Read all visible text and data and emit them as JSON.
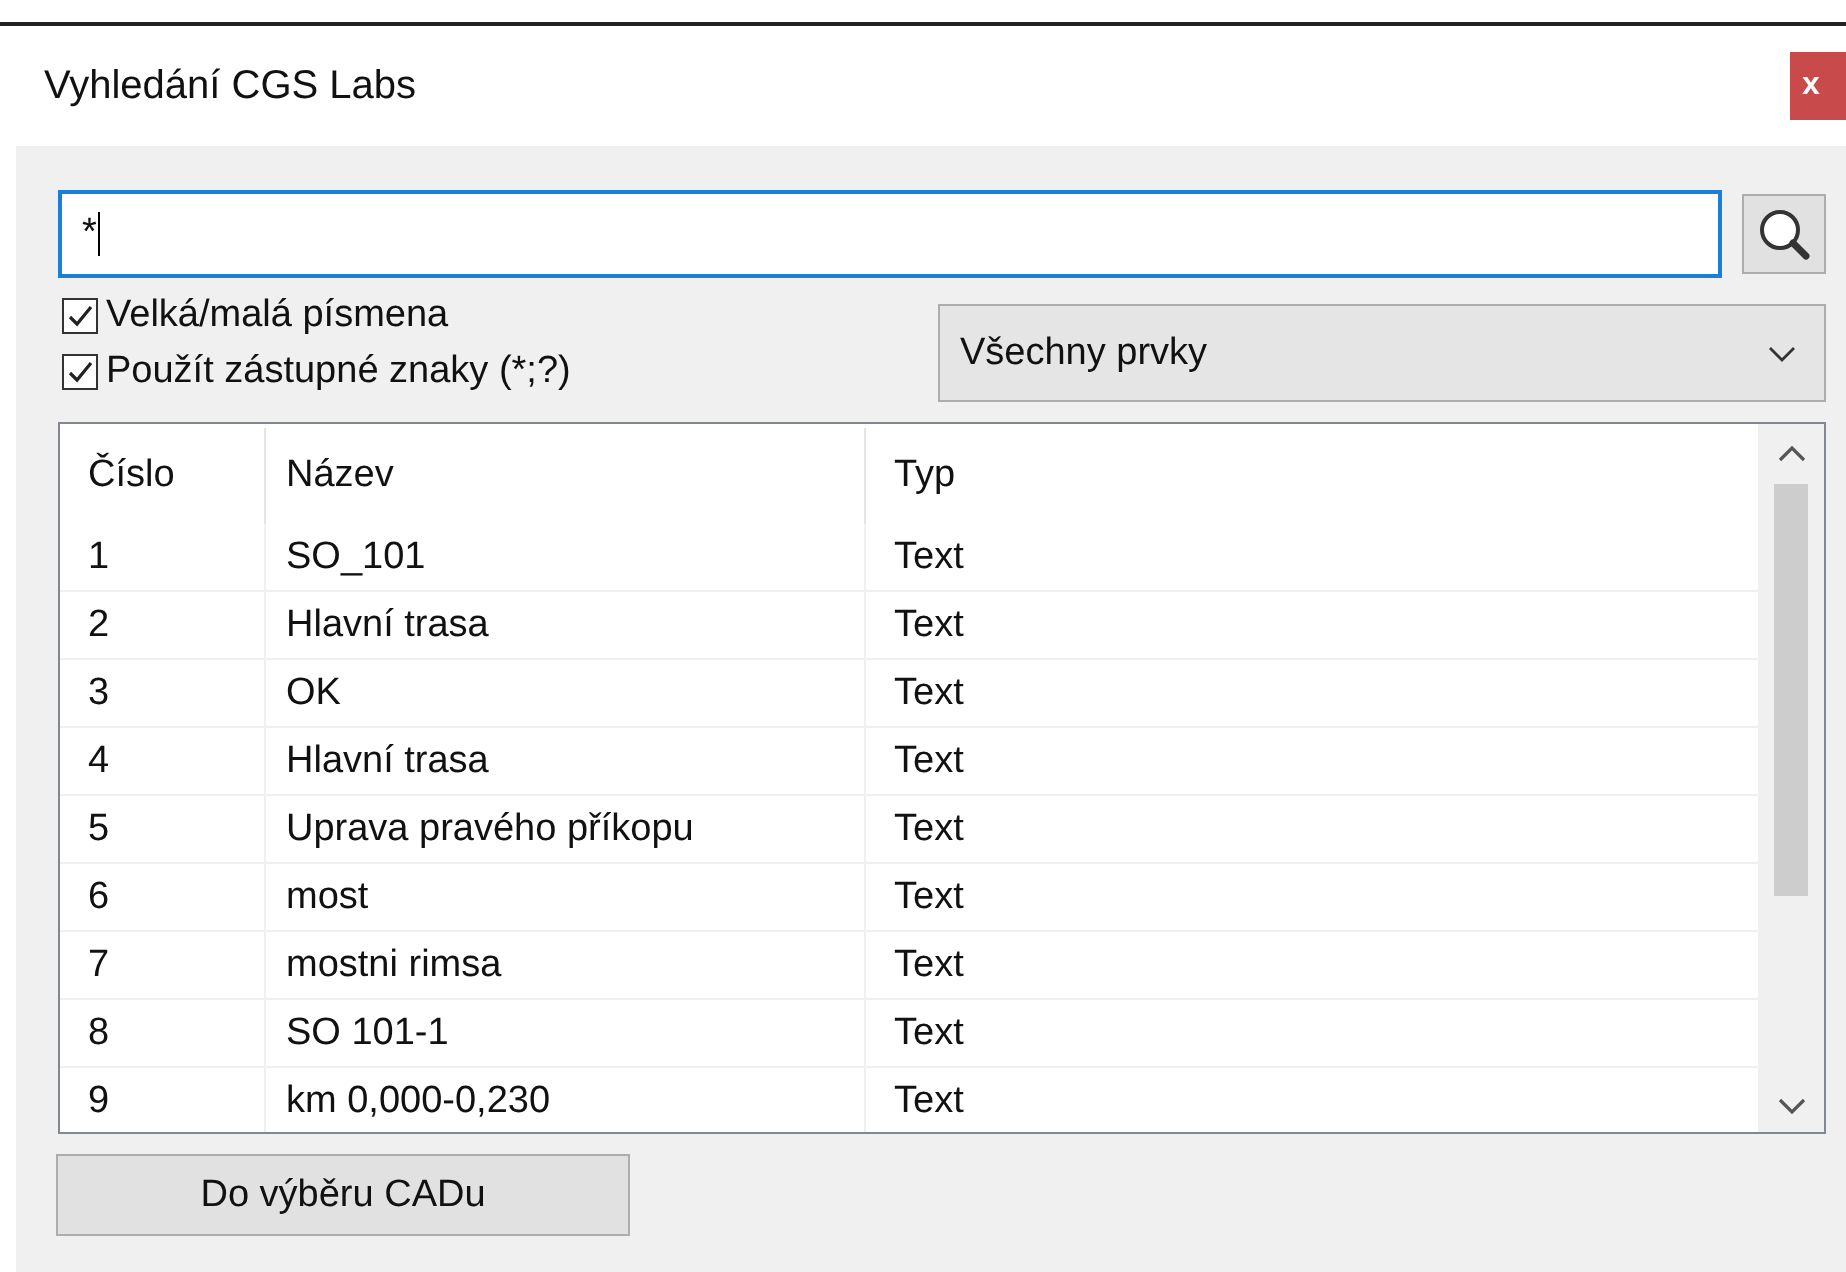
{
  "window": {
    "title": "Vyhledání CGS Labs",
    "close": "x"
  },
  "search": {
    "value": "*"
  },
  "options": [
    {
      "label": "Velká/malá písmena",
      "checked": true
    },
    {
      "label": "Použít zástupné znaky (*;?)",
      "checked": true
    }
  ],
  "filter": {
    "value": "Všechny prvky"
  },
  "table": {
    "columns": [
      "Číslo",
      "Název",
      "Typ"
    ],
    "rows": [
      [
        "1",
        "SO_101",
        "Text"
      ],
      [
        "2",
        "Hlavní trasa",
        "Text"
      ],
      [
        "3",
        "OK",
        "Text"
      ],
      [
        "4",
        "Hlavní trasa",
        "Text"
      ],
      [
        "5",
        "Uprava pravého příkopu",
        "Text"
      ],
      [
        "6",
        "most",
        "Text"
      ],
      [
        "7",
        "mostni rimsa",
        "Text"
      ],
      [
        "8",
        "SO 101-1",
        "Text"
      ],
      [
        "9",
        "km 0,000-0,230",
        "Text"
      ]
    ]
  },
  "buttons": [
    "Do výběru CADu"
  ]
}
